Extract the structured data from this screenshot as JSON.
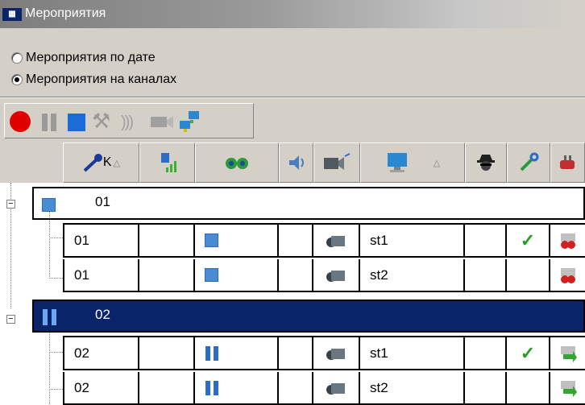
{
  "window": {
    "title": "Мероприятия",
    "icon": "app-icon"
  },
  "radio": {
    "by_date": {
      "label": "Мероприятия по дате",
      "checked": false
    },
    "by_channels": {
      "label": "Мероприятия на каналах",
      "checked": true
    }
  },
  "toolbar": {
    "buttons": [
      "record-icon",
      "pause-icon",
      "stop-icon",
      "tools-icon",
      "signal-waves-icon",
      "camera-icon",
      "network-icon"
    ]
  },
  "columns": {
    "key_label": "K",
    "sort_indicator": "△",
    "icons": [
      "key-icon",
      "signal-icon",
      "binoculars-icon",
      "speaker-icon",
      "camera-icon",
      "monitor-icon",
      "spy-icon",
      "wrench-icon",
      "plug-icon"
    ]
  },
  "groups": [
    {
      "id": "01",
      "state": "stop",
      "selected": false,
      "rows": [
        {
          "key": "01",
          "state": "stop",
          "station": "st1",
          "ok": "✓",
          "status": "red"
        },
        {
          "key": "01",
          "state": "stop",
          "station": "st2",
          "ok": "",
          "status": "red"
        }
      ]
    },
    {
      "id": "02",
      "state": "pause",
      "selected": true,
      "rows": [
        {
          "key": "02",
          "state": "pause",
          "station": "st1",
          "ok": "✓",
          "status": "green"
        },
        {
          "key": "02",
          "state": "pause",
          "station": "st2",
          "ok": "",
          "status": "green"
        }
      ]
    }
  ],
  "colors": {
    "selection": "#0a246a",
    "record": "#e00000",
    "stop": "#1c6cd8",
    "check": "#22a020"
  }
}
